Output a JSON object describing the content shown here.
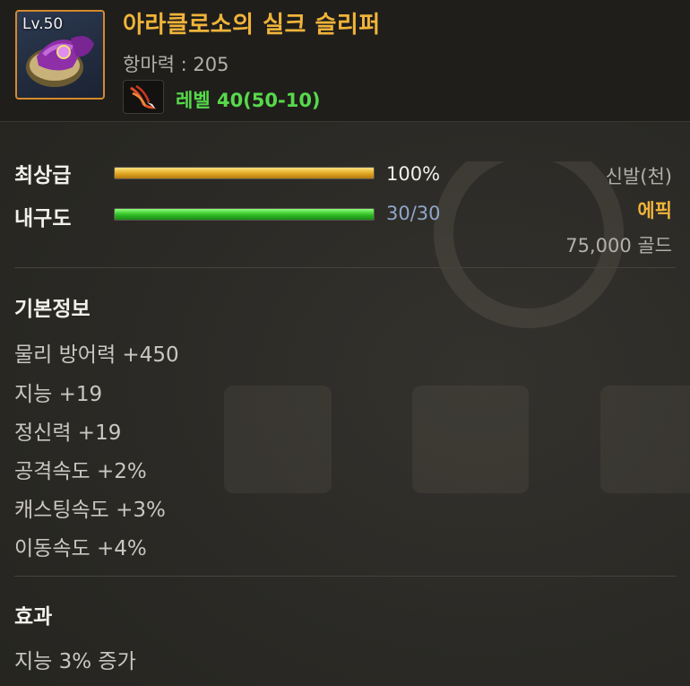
{
  "item": {
    "level_badge": "Lv.50",
    "name": "아라클로소의 실크 슬리퍼",
    "resist": "항마력 : 205",
    "required_level": "레벨 40(50-10)",
    "icon": "slipper-icon",
    "req_icon": "phoenix-feather-icon"
  },
  "grade": {
    "label": "최상급",
    "value": "100%",
    "fill": 1.0
  },
  "durability": {
    "label": "내구도",
    "value": "30/30",
    "fill": 1.0
  },
  "side": {
    "type": "신발(천)",
    "rarity": "에픽",
    "price": "75,000 골드"
  },
  "basic": {
    "title": "기본정보",
    "stats": [
      "물리 방어력 +450",
      "지능 +19",
      "정신력 +19",
      "공격속도 +2%",
      "캐스팅속도 +3%",
      "이동속도 +4%"
    ]
  },
  "effect": {
    "title": "효과",
    "lines": [
      "지능 3% 증가"
    ]
  },
  "colors": {
    "name": "#f0b43a",
    "rarity_epic": "#f0b43a",
    "required_level": "#57d94b",
    "grade_bar": "#e0a620",
    "durability_bar": "#2fbd24"
  }
}
